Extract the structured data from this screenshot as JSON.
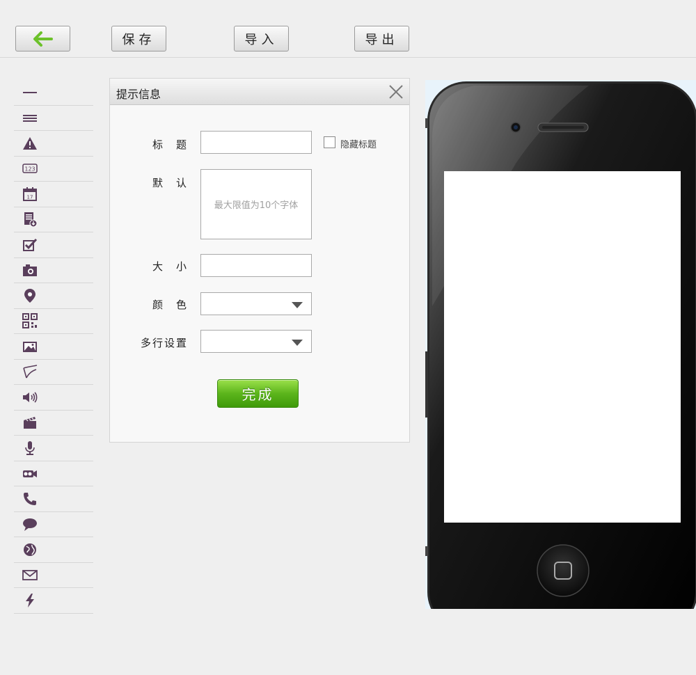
{
  "toolbar": {
    "back_icon": "arrow-left-icon",
    "save_label": "保存",
    "import_label": "导入",
    "export_label": "导出",
    "accent_color": "#6cc12a"
  },
  "tools": [
    {
      "icon": "single-line-icon"
    },
    {
      "icon": "multi-line-icon"
    },
    {
      "icon": "warning-icon"
    },
    {
      "icon": "number-icon"
    },
    {
      "icon": "calendar-icon"
    },
    {
      "icon": "document-download-icon"
    },
    {
      "icon": "checkbox-icon"
    },
    {
      "icon": "camera-icon"
    },
    {
      "icon": "location-pin-icon"
    },
    {
      "icon": "qr-code-icon"
    },
    {
      "icon": "image-icon"
    },
    {
      "icon": "signature-icon"
    },
    {
      "icon": "speaker-icon"
    },
    {
      "icon": "video-clapper-icon"
    },
    {
      "icon": "microphone-icon"
    },
    {
      "icon": "video-camera-icon"
    },
    {
      "icon": "phone-icon"
    },
    {
      "icon": "chat-bubble-icon"
    },
    {
      "icon": "globe-icon"
    },
    {
      "icon": "mail-icon"
    },
    {
      "icon": "lightning-icon"
    }
  ],
  "dialog": {
    "title": "提示信息",
    "close_icon": "close-icon",
    "title_label": "标　题",
    "title_value": "",
    "hide_title_label": "隐藏标题",
    "hide_title_checked": false,
    "default_label": "默　认",
    "default_placeholder": "最大限值为10个字体",
    "size_label": "大　小",
    "size_value": "",
    "color_label": "颜　色",
    "color_value": "",
    "multiline_label": "多行设置",
    "multiline_value": "",
    "done_label": "完成"
  },
  "phone": {
    "icon": "smartphone-preview",
    "screen_color": "#ffffff"
  }
}
